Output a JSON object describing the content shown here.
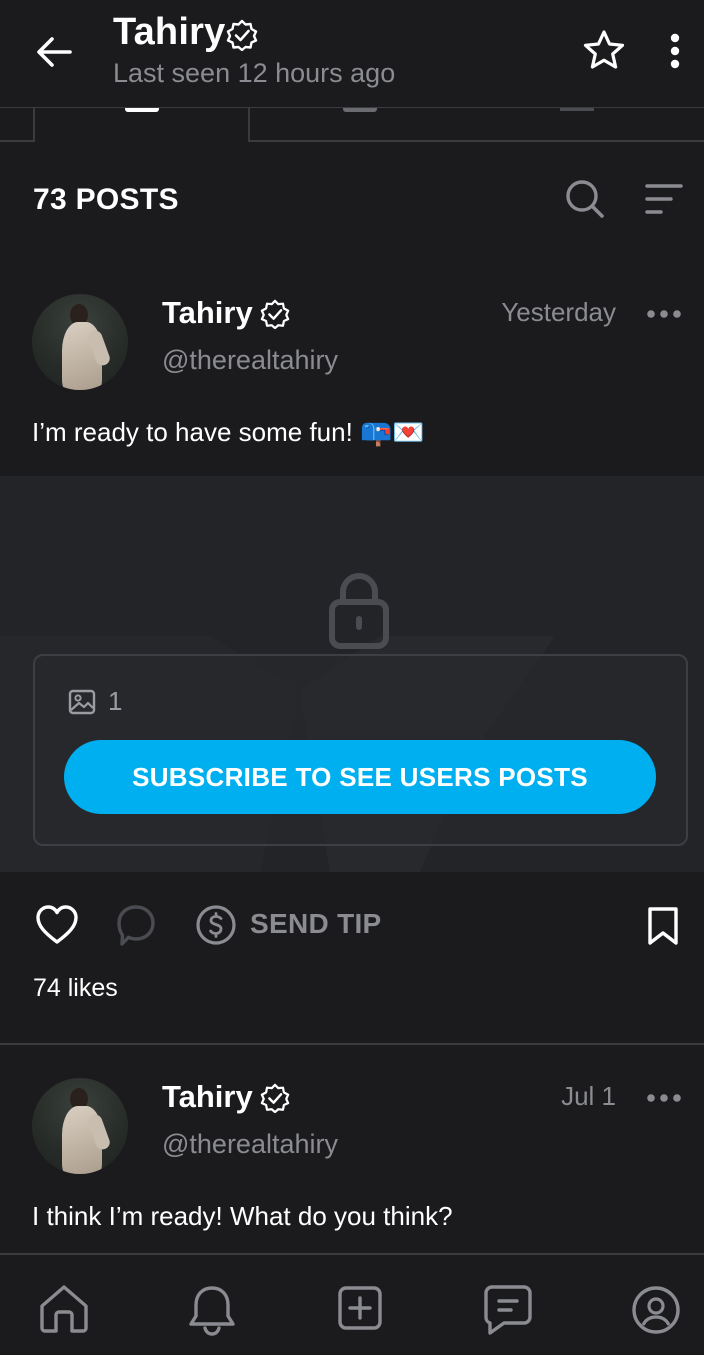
{
  "header": {
    "title": "Tahiry",
    "subtitle": "Last seen 12 hours ago",
    "icons": [
      "back-arrow-icon",
      "verified-icon",
      "star-icon",
      "more-vertical-icon"
    ]
  },
  "posts_bar": {
    "count_label": "73 POSTS",
    "icons": [
      "search-icon",
      "sort-icon"
    ]
  },
  "posts": [
    {
      "name": "Tahiry",
      "handle": "@therealtahiry",
      "time": "Yesterday",
      "text": "I’m ready to have some fun! 📪💌",
      "locked": {
        "media_count": "1",
        "subscribe_label": "SUBSCRIBE TO SEE USERS POSTS"
      },
      "actions": {
        "tip_label": "SEND TIP"
      },
      "likes": "74 likes"
    },
    {
      "name": "Tahiry",
      "handle": "@therealtahiry",
      "time": "Jul 1",
      "text": "I think I’m ready! What do you think?"
    }
  ],
  "bottom_nav": [
    "home-icon",
    "bell-icon",
    "add-post-icon",
    "messages-icon",
    "profile-icon"
  ],
  "colors": {
    "background": "#1b1b1d",
    "locked_bg": "#232428",
    "accent": "#00aff0",
    "muted_text": "#8a8c91",
    "divider": "#3a3b3f"
  }
}
